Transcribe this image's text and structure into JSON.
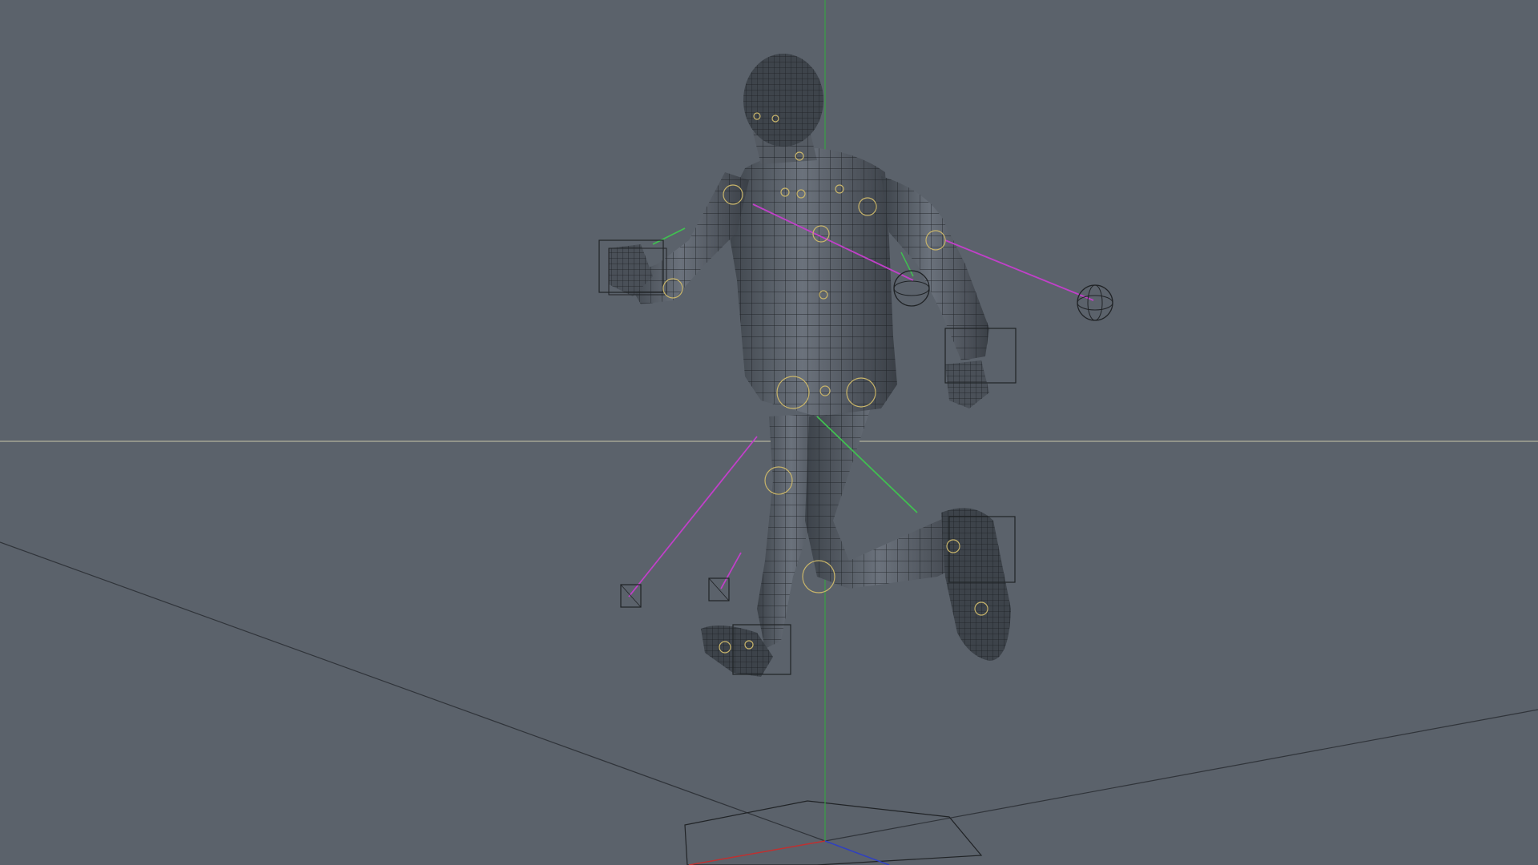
{
  "viewport": {
    "background": "#5b626b",
    "grid_line_color": "#30343a",
    "horizon_color": "#c9c6a8",
    "axis_y_color": "#3aa046",
    "axis_x_color": "#c03030",
    "axis_z_color": "#3040c0"
  },
  "character": {
    "mesh_fill": "#4a5058",
    "mesh_wire": "#1d2024",
    "mesh_highlight": "#7a8290"
  },
  "rig": {
    "joint_color": "#c9b56a",
    "ik_line_color": "#c040c8",
    "fk_line_color": "#40c050",
    "control_box_color": "#202326"
  }
}
